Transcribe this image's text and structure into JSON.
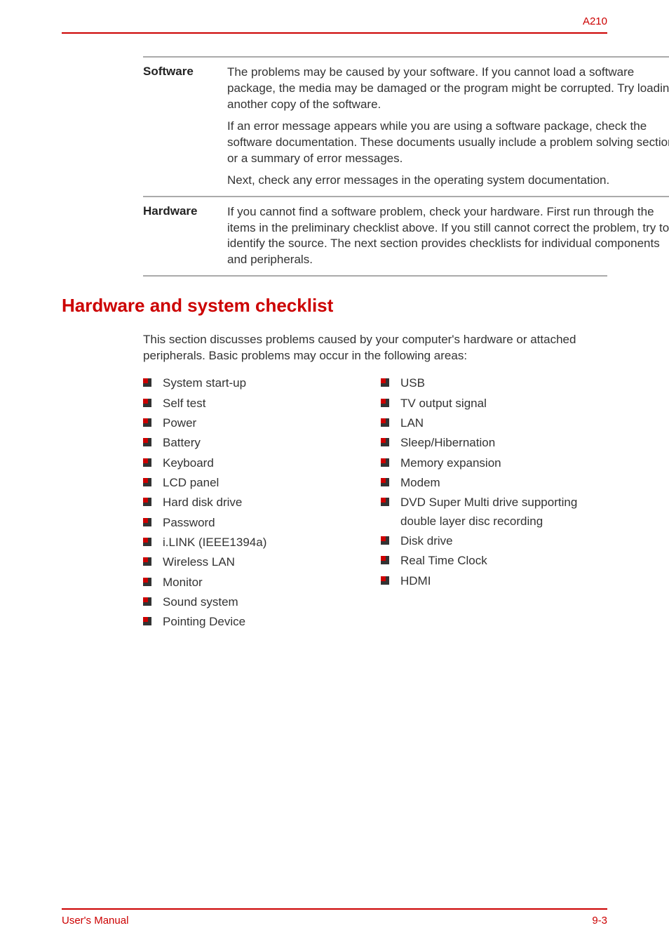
{
  "header": {
    "model": "A210"
  },
  "definitions": [
    {
      "term": "Software",
      "paragraphs": [
        "The problems may be caused by your software. If you cannot load a software package, the media may be damaged or the program might be corrupted. Try loading another copy of the software.",
        "If an error message appears while you are using a software package, check the software documentation. These documents usually include a problem solving section or a summary of error messages.",
        "Next, check any error messages in the operating system documentation."
      ]
    },
    {
      "term": "Hardware",
      "paragraphs": [
        "If you cannot find a software problem, check your hardware. First run through the items in the preliminary checklist above. If you still cannot correct the problem, try to identify the source. The next section provides checklists for individual components and peripherals."
      ]
    }
  ],
  "section": {
    "heading": "Hardware and system checklist",
    "intro": "This section discusses problems caused by your computer's hardware or attached peripherals. Basic problems may occur in the following areas:",
    "leftItems": [
      "System start-up",
      "Self test",
      "Power",
      "Battery",
      "Keyboard",
      "LCD panel",
      "Hard disk drive",
      "Password",
      "i.LINK (IEEE1394a)",
      "Wireless LAN",
      "Monitor",
      "Sound system",
      "Pointing Device"
    ],
    "rightItems": [
      "USB",
      "TV output signal",
      "LAN",
      "Sleep/Hibernation",
      "Memory expansion",
      "Modem",
      "DVD Super Multi drive supporting double layer disc recording",
      "Disk drive",
      "Real Time Clock",
      "HDMI"
    ]
  },
  "footer": {
    "left": "User's Manual",
    "right": "9-3"
  }
}
